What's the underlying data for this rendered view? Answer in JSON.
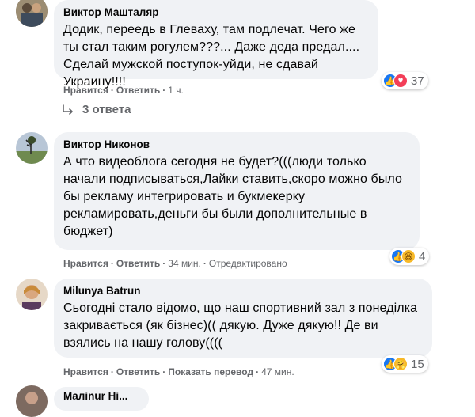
{
  "comments": [
    {
      "author": "Виктор Машталяр",
      "text": "Додик, переедь в Глеваху, там подлечат. Чего же ты стал таким рогулем???... Даже деда предал.... Сделай мужской поступок-уйди, не сдавай Украину!!!!",
      "actions": {
        "like": "Нравится",
        "reply": "Ответить",
        "time": "1 ч."
      },
      "reactions": {
        "icons": [
          "like-icon",
          "love-icon"
        ],
        "count": "37"
      },
      "replies_label": "3 ответа"
    },
    {
      "author": "Виктор Никонов",
      "text": "А что видеоблога сегодня не будет?(((люди только начали подписываться,Лайки ставить,скоро можно было бы рекламу интегрировать и букмекерку рекламировать,деньги бы были дополнительные в бюджет)",
      "actions": {
        "like": "Нравится",
        "reply": "Ответить",
        "time": "34 мин.",
        "edited": "Отредактировано"
      },
      "reactions": {
        "icons": [
          "like-icon",
          "haha-icon"
        ],
        "count": "4"
      }
    },
    {
      "author": "Milunya Batrun",
      "text": "Сьогодні стало відомо, що наш спортивний зал з понеділка закривається (як бізнес)(( дякую. Дуже дякую!! Де ви взялись на нашу голову((((",
      "actions": {
        "like": "Нравится",
        "reply": "Ответить",
        "translate": "Показать перевод",
        "time": "47 мин."
      },
      "reactions": {
        "icons": [
          "like-icon",
          "care-icon"
        ],
        "count": "15"
      }
    },
    {
      "author": "Maлinur Hi..."
    }
  ],
  "colors": {
    "bubble": "#f0f2f5",
    "meta": "#65676b",
    "like": "#1877f2",
    "love": "#f33e58",
    "haha": "#f7b928"
  }
}
